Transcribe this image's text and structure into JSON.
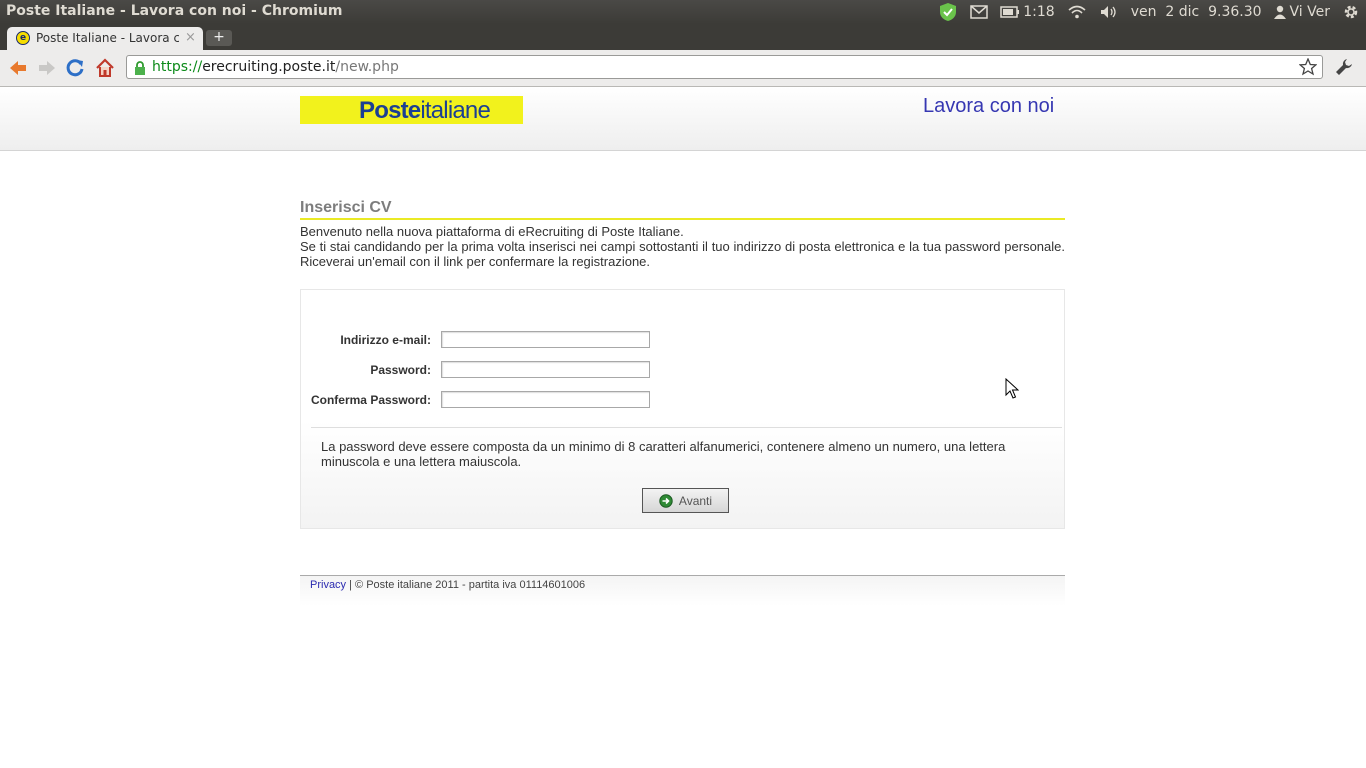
{
  "os": {
    "window_title": "Poste Italiane - Lavora con noi - Chromium",
    "battery_time": "1:18",
    "clock": "ven  2 dic  9.36.30",
    "user": "Vi Ver"
  },
  "browser": {
    "tab_title": "Poste Italiane - Lavora con noi",
    "url_scheme": "https://",
    "url_host": "erecruiting.poste.it",
    "url_path": "/new.php"
  },
  "header": {
    "logo_bold": "Poste",
    "logo_regular": "italiane",
    "title": "Lavora con noi"
  },
  "main": {
    "section_title": "Inserisci CV",
    "intro_line1": "Benvenuto nella nuova piattaforma di eRecruiting di Poste Italiane.",
    "intro_line2": "Se ti stai candidando per la prima volta inserisci nei campi sottostanti il tuo indirizzo di posta elettronica e la tua password personale. Riceverai un'email con il link per confermare la registrazione."
  },
  "form": {
    "email_label": "Indirizzo e-mail:",
    "email_value": "",
    "password_label": "Password:",
    "password_value": "",
    "confirm_label": "Conferma Password:",
    "confirm_value": "",
    "note": "La password deve essere composta da un minimo di 8 caratteri alfanumerici, contenere almeno un numero, una lettera minuscola e una lettera maiuscola.",
    "submit_label": "Avanti"
  },
  "footer": {
    "privacy_link": "Privacy",
    "copyright": " | © Poste italiane 2011 - partita iva 01114601006"
  },
  "colors": {
    "logo_yellow": "#f2f21c",
    "logo_blue": "#1b3f93",
    "header_title": "#3637b2",
    "section_rule": "#eaea25"
  }
}
